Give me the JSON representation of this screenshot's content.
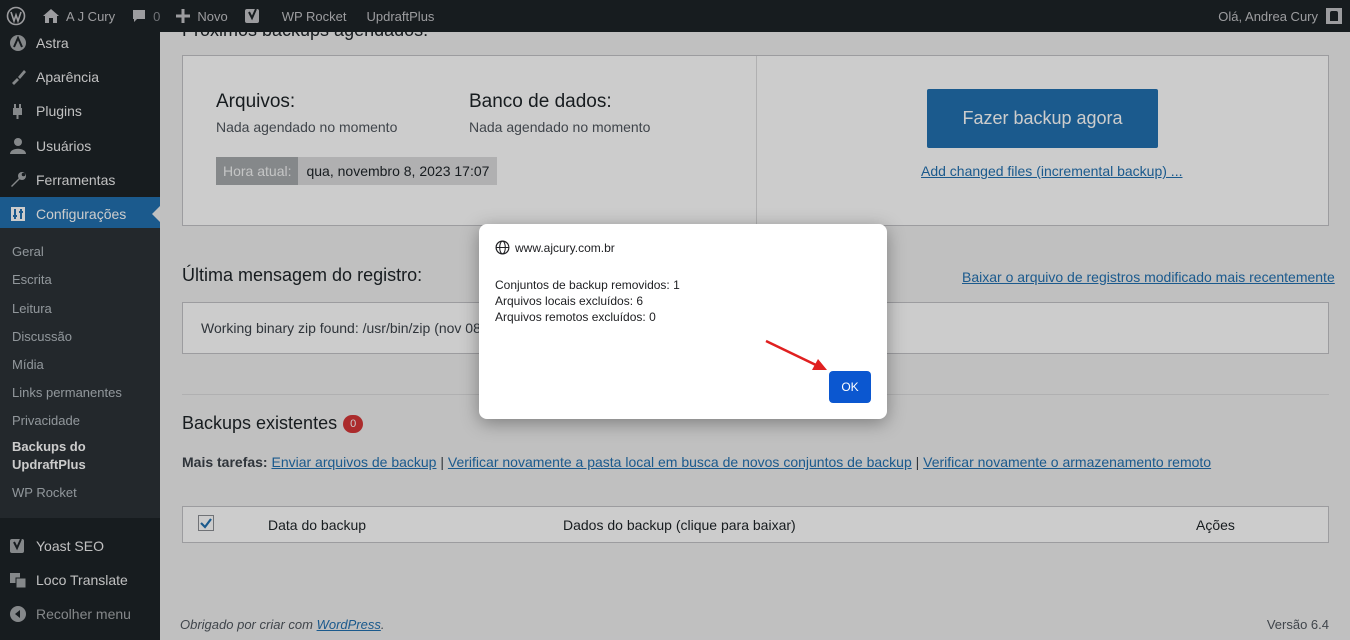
{
  "adminbar": {
    "site_name": "A J Cury",
    "comments_count": "0",
    "new_label": "Novo",
    "wp_rocket": "WP Rocket",
    "updraftplus": "UpdraftPlus",
    "greeting": "Olá, Andrea Cury"
  },
  "sidebar": {
    "items": [
      {
        "label": "Astra",
        "icon": "astra-icon"
      },
      {
        "label": "Aparência",
        "icon": "paintbrush-icon"
      },
      {
        "label": "Plugins",
        "icon": "plugin-icon"
      },
      {
        "label": "Usuários",
        "icon": "users-icon"
      },
      {
        "label": "Ferramentas",
        "icon": "wrench-icon"
      },
      {
        "label": "Configurações",
        "icon": "settings-icon"
      },
      {
        "label": "Yoast SEO",
        "icon": "yoast-icon"
      },
      {
        "label": "Loco Translate",
        "icon": "translate-icon"
      },
      {
        "label": "Recolher menu",
        "icon": "collapse-icon"
      }
    ],
    "submenu": [
      "Geral",
      "Escrita",
      "Leitura",
      "Discussão",
      "Mídia",
      "Links permanentes",
      "Privacidade",
      "Backups do UpdraftPlus",
      "WP Rocket"
    ]
  },
  "schedule": {
    "heading": "Próximos backups agendados:",
    "files_title": "Arquivos:",
    "files_status": "Nada agendado no momento",
    "db_title": "Banco de dados:",
    "db_status": "Nada agendado no momento",
    "time_label": "Hora atual:",
    "time_value": "qua, novembro 8, 2023 17:07",
    "backup_now": "Fazer backup agora",
    "incremental_link": "Add changed files (incremental backup) ..."
  },
  "log": {
    "heading": "Última mensagem do registro:",
    "download_link": "Baixar o arquivo de registros modificado mais recentemente",
    "message": "Working binary zip found: /usr/bin/zip (nov 08"
  },
  "existing": {
    "heading": "Backups existentes",
    "count": "0",
    "more_tasks": "Mais tarefas:",
    "upload_link": "Enviar arquivos de backup",
    "rescan_local_link": "Verificar novamente a pasta local em busca de novos conjuntos de backup",
    "rescan_remote_link": "Verificar novamente o armazenamento remoto",
    "sep": "|",
    "columns": [
      "Data do backup",
      "Dados do backup (clique para baixar)",
      "Ações"
    ]
  },
  "footer": {
    "thanks_prefix": "Obrigado por criar com ",
    "wordpress_link": "WordPress",
    "thanks_suffix": ".",
    "version": "Versão 6.4"
  },
  "dialog": {
    "origin": "www.ajcury.com.br",
    "lines": [
      "Conjuntos de backup removidos: 1",
      "Arquivos locais excluídos: 6",
      "Arquivos remotos excluídos: 0"
    ],
    "ok": "OK"
  },
  "colors": {
    "admin_bar": "#1d2327",
    "primary": "#2271b1",
    "dialog_ok": "#0b57d0",
    "annotation_arrow": "#e02020"
  }
}
